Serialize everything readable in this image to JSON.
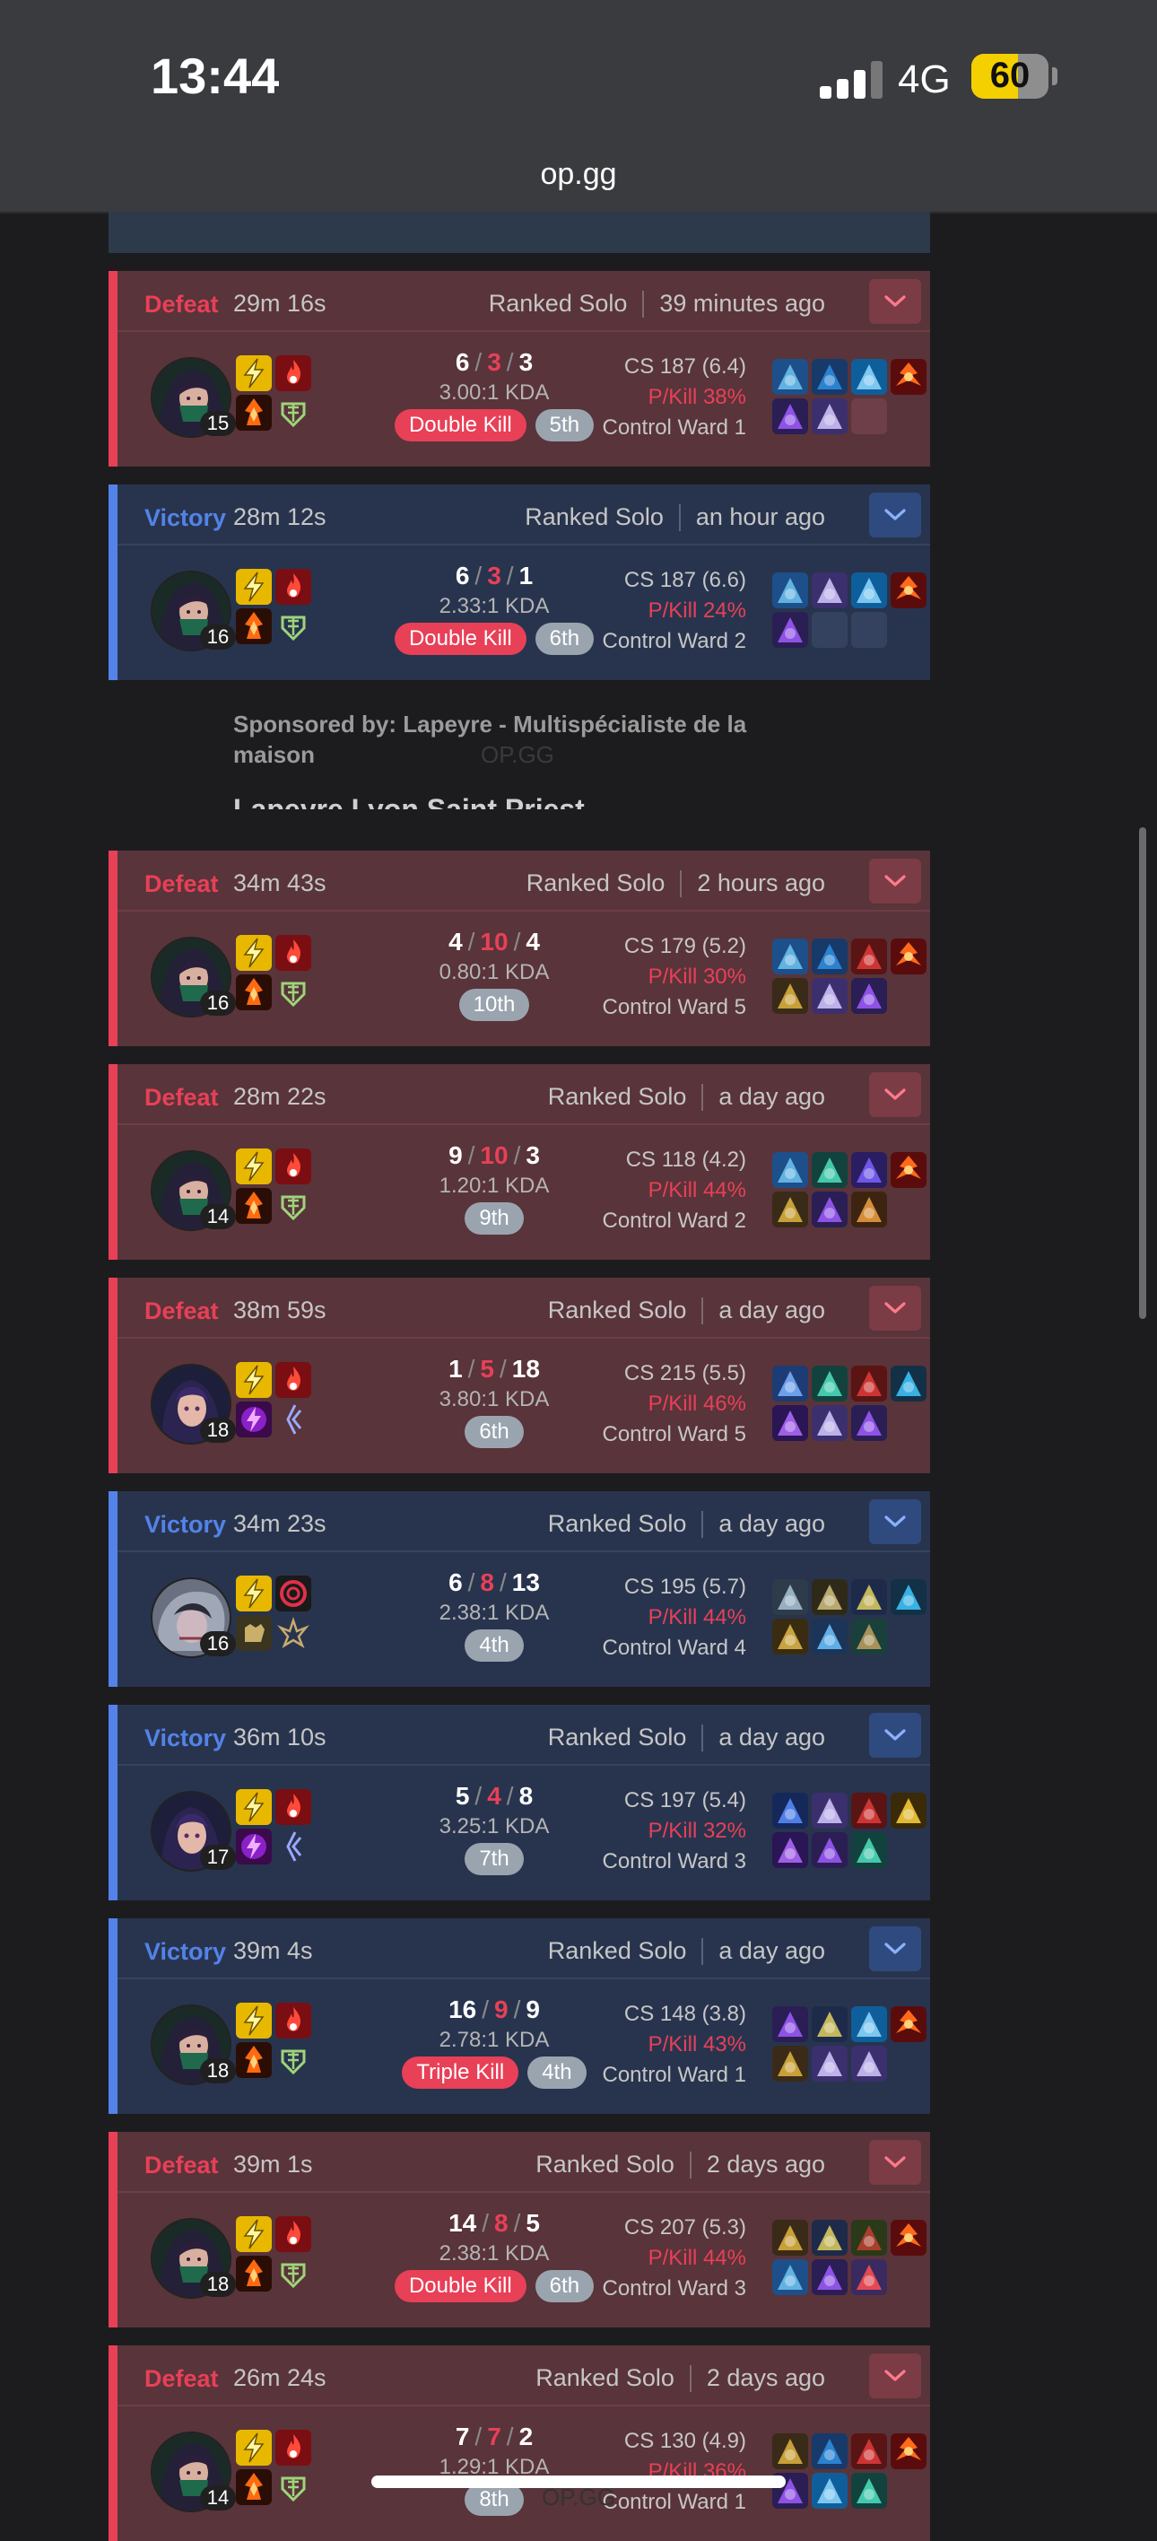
{
  "status_bar": {
    "time": "13:44",
    "network": "4G",
    "battery": "60",
    "battery_level": 0.6
  },
  "browser": {
    "url": "op.gg"
  },
  "ad": {
    "sponsor": "Sponsored by: Lapeyre - Multispécialiste de la maison",
    "watermark": "OP.GG",
    "title": "Lapeyre Lyon Saint Priest"
  },
  "footer_watermark": "OP.GG",
  "colors": {
    "defeat": "#e84057",
    "victory": "#5383e8",
    "placement": "#9aa4af"
  },
  "matches": [
    {
      "result": "Defeat",
      "duration": "29m 16s",
      "queue": "Ranked Solo",
      "time_ago": "39 minutes ago",
      "champion_icon": "akali-icon",
      "level": "15",
      "spells": [
        "flash-icon",
        "ignite-icon",
        "conqueror-rune-icon",
        "resolve-rune-icon"
      ],
      "k": "6",
      "d": "3",
      "a": "3",
      "kda": "3.00:1 KDA",
      "multikill": "Double Kill",
      "placement": "5th",
      "cs": "CS 187 (6.4)",
      "pkill": "P/Kill 38%",
      "ward": "Control Ward 1",
      "items": [
        "a",
        "b",
        "c",
        "t",
        "d",
        "e",
        "x"
      ]
    },
    {
      "result": "Victory",
      "duration": "28m 12s",
      "queue": "Ranked Solo",
      "time_ago": "an hour ago",
      "champion_icon": "akali-icon",
      "level": "16",
      "spells": [
        "flash-icon",
        "ignite-icon",
        "conqueror-rune-icon",
        "resolve-rune-icon"
      ],
      "k": "6",
      "d": "3",
      "a": "1",
      "kda": "2.33:1 KDA",
      "multikill": "Double Kill",
      "placement": "6th",
      "cs": "CS 187 (6.6)",
      "pkill": "P/Kill 24%",
      "ward": "Control Ward 2",
      "items": [
        "a",
        "e",
        "c",
        "t",
        "d",
        "x",
        "x"
      ]
    },
    {
      "result": "Defeat",
      "duration": "34m 43s",
      "queue": "Ranked Solo",
      "time_ago": "2 hours ago",
      "champion_icon": "akali-icon",
      "level": "16",
      "spells": [
        "flash-icon",
        "ignite-icon",
        "conqueror-rune-icon",
        "resolve-rune-icon"
      ],
      "k": "4",
      "d": "10",
      "a": "4",
      "kda": "0.80:1 KDA",
      "multikill": "",
      "placement": "10th",
      "cs": "CS 179 (5.2)",
      "pkill": "P/Kill 30%",
      "ward": "Control Ward 5",
      "items": [
        "a",
        "b",
        "f",
        "t",
        "g",
        "e",
        "d"
      ]
    },
    {
      "result": "Defeat",
      "duration": "28m 22s",
      "queue": "Ranked Solo",
      "time_ago": "a day ago",
      "champion_icon": "akali-icon",
      "level": "14",
      "spells": [
        "flash-icon",
        "ignite-icon",
        "conqueror-rune-icon",
        "resolve-rune-icon"
      ],
      "k": "9",
      "d": "10",
      "a": "3",
      "kda": "1.20:1 KDA",
      "multikill": "",
      "placement": "9th",
      "cs": "CS 118 (4.2)",
      "pkill": "P/Kill 44%",
      "ward": "Control Ward 2",
      "items": [
        "a",
        "h",
        "i",
        "t",
        "g",
        "d",
        "j"
      ]
    },
    {
      "result": "Defeat",
      "duration": "38m 59s",
      "queue": "Ranked Solo",
      "time_ago": "a day ago",
      "champion_icon": "ahri-icon",
      "level": "18",
      "spells": [
        "flash-icon",
        "ignite-icon",
        "electrocute-rune-icon",
        "sorcery-rune-icon"
      ],
      "k": "1",
      "d": "5",
      "a": "18",
      "kda": "3.80:1 KDA",
      "multikill": "",
      "placement": "6th",
      "cs": "CS 215 (5.5)",
      "pkill": "P/Kill 46%",
      "ward": "Control Ward 5",
      "items": [
        "k",
        "h",
        "f",
        "w",
        "l",
        "e",
        "d"
      ]
    },
    {
      "result": "Victory",
      "duration": "34m 23s",
      "queue": "Ranked Solo",
      "time_ago": "a day ago",
      "champion_icon": "vex-icon",
      "level": "16",
      "spells": [
        "flash-icon",
        "spiral-spell-icon",
        "grasp-rune-icon",
        "precision-rune-icon"
      ],
      "k": "6",
      "d": "8",
      "a": "13",
      "kda": "2.38:1 KDA",
      "multikill": "",
      "placement": "4th",
      "cs": "CS 195 (5.7)",
      "pkill": "P/Kill 44%",
      "ward": "Control Ward 4",
      "items": [
        "m",
        "n",
        "o",
        "w",
        "p",
        "q",
        "r"
      ]
    },
    {
      "result": "Victory",
      "duration": "36m 10s",
      "queue": "Ranked Solo",
      "time_ago": "a day ago",
      "champion_icon": "ahri-icon",
      "level": "17",
      "spells": [
        "flash-icon",
        "ignite-icon",
        "electrocute-rune-icon",
        "sorcery-rune-icon"
      ],
      "k": "5",
      "d": "4",
      "a": "8",
      "kda": "3.25:1 KDA",
      "multikill": "",
      "placement": "7th",
      "cs": "CS 197 (5.4)",
      "pkill": "P/Kill 32%",
      "ward": "Control Ward 3",
      "items": [
        "s",
        "e",
        "f",
        "y",
        "l",
        "d",
        "h"
      ]
    },
    {
      "result": "Victory",
      "duration": "39m 4s",
      "queue": "Ranked Solo",
      "time_ago": "a day ago",
      "champion_icon": "akali-icon",
      "level": "18",
      "spells": [
        "flash-icon",
        "ignite-icon",
        "conqueror-rune-icon",
        "resolve-rune-icon"
      ],
      "k": "16",
      "d": "9",
      "a": "9",
      "kda": "2.78:1 KDA",
      "multikill": "Triple Kill",
      "placement": "4th",
      "cs": "CS 148 (3.8)",
      "pkill": "P/Kill 43%",
      "ward": "Control Ward 1",
      "items": [
        "d",
        "o",
        "c",
        "t",
        "g",
        "e",
        "e"
      ]
    },
    {
      "result": "Defeat",
      "duration": "39m 1s",
      "queue": "Ranked Solo",
      "time_ago": "2 days ago",
      "champion_icon": "akali-icon",
      "level": "18",
      "spells": [
        "flash-icon",
        "ignite-icon",
        "conqueror-rune-icon",
        "resolve-rune-icon"
      ],
      "k": "14",
      "d": "8",
      "a": "5",
      "kda": "2.38:1 KDA",
      "multikill": "Double Kill",
      "placement": "6th",
      "cs": "CS 207 (5.3)",
      "pkill": "P/Kill 44%",
      "ward": "Control Ward 3",
      "items": [
        "g",
        "o",
        "u",
        "t",
        "a",
        "d",
        "v"
      ]
    },
    {
      "result": "Defeat",
      "duration": "26m 24s",
      "queue": "Ranked Solo",
      "time_ago": "2 days ago",
      "champion_icon": "akali-icon",
      "level": "14",
      "spells": [
        "flash-icon",
        "ignite-icon",
        "conqueror-rune-icon",
        "resolve-rune-icon"
      ],
      "k": "7",
      "d": "7",
      "a": "2",
      "kda": "1.29:1 KDA",
      "multikill": "",
      "placement": "8th",
      "cs": "CS 130 (4.9)",
      "pkill": "P/Kill 36%",
      "ward": "Control Ward 1",
      "items": [
        "g",
        "b",
        "f",
        "t",
        "d",
        "c",
        "h"
      ]
    }
  ]
}
